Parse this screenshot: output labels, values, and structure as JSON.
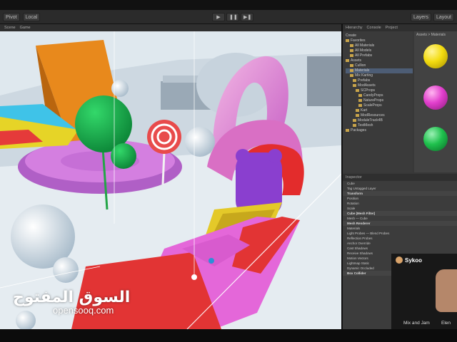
{
  "toolbar": {
    "left_buttons": [
      "Pivot",
      "Local"
    ],
    "play_icons": [
      "play-icon",
      "pause-icon",
      "step-icon"
    ],
    "layers_label": "Layers",
    "layout_label": "Layout"
  },
  "tabs": {
    "scene": "Scene",
    "game": "Game",
    "hierarchy": "Hierarchy",
    "console": "Console",
    "project": "Project"
  },
  "project": {
    "create_label": "Create",
    "tree": [
      "Favorites",
      "All Materials",
      "All Models",
      "All Prefabs",
      "Assets",
      "Cullion",
      "Materials",
      "Mix Karting",
      "Prefabs",
      "ModAssets",
      "SCProps",
      "CandyProps",
      "NatureProps",
      "ScaleProps",
      "Kart",
      "ModResources",
      "ModuleTrack4B",
      "TestMesh",
      "Packages"
    ],
    "assets_header": "Assets > Materials",
    "material_colors": [
      "#f3dc10",
      "#e23fcd",
      "#1fc14d"
    ]
  },
  "inspector": {
    "tab": "Inspector",
    "object_name": "Cube",
    "tag_label": "Tag",
    "tag_value": "Untagged",
    "layer_label": "Layer",
    "transform": "Transform",
    "position": "Position",
    "rotation": "Rotation",
    "scale": "Scale",
    "mesh_filter": "Cube (Mesh Filter)",
    "mesh_label": "Mesh",
    "mesh_value": "Cube",
    "mesh_renderer": "Mesh Renderer",
    "materials": "Materials",
    "light_probes": "Light Probes",
    "light_probes_value": "Blend Probes",
    "reflection_probes": "Reflection Probes",
    "anchor_override": "Anchor Override",
    "cast_shadows": "Cast Shadows",
    "receive_shadows": "Receive Shadows",
    "motion_vectors": "Motion Vectors",
    "lightmap_static": "Lightmap Static",
    "dynamic_occluded": "Dynamic Occluded",
    "box_collider": "Box Collider"
  },
  "webcam": {
    "streamer": "Sykoo"
  },
  "captions": {
    "mix_and_jam": "Mix and Jam",
    "other": "Elen"
  },
  "watermark": {
    "arabic": "السوق المفتوح",
    "latin": "opensooq.com"
  }
}
